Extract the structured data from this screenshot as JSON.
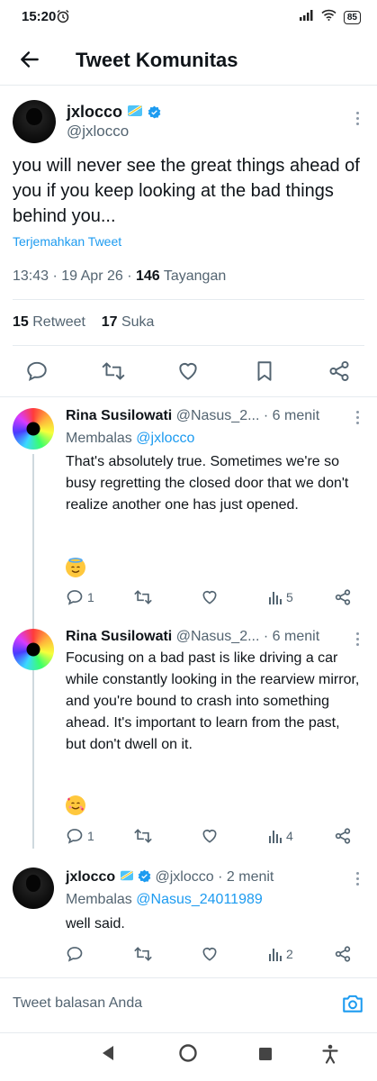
{
  "status_bar": {
    "time": "15:20",
    "battery": "85"
  },
  "header": {
    "title": "Tweet Komunitas"
  },
  "main_tweet": {
    "name": "jxlocco",
    "handle": "@jxlocco",
    "text": "you will never see the great things ahead of you if you keep looking at the bad things behind you...",
    "translate": "Terjemahkan Tweet",
    "time": "13:43",
    "date": "19 Apr 26",
    "views_count": "146",
    "views_label": "Tayangan",
    "retweets_count": "15",
    "retweets_label": "Retweet",
    "likes_count": "17",
    "likes_label": "Suka"
  },
  "replies": [
    {
      "name": "Rina Susilowati",
      "handle": "@Nasus_2...",
      "time": "6 menit",
      "replying_prefix": "Membalas",
      "replying_to": "@jxlocco",
      "text": "That's absolutely true. Sometimes we're so busy regretting the closed door that we don't realize another one has just opened.",
      "emoji": "smiling-face-with-halo",
      "reply_count": "1",
      "views": "5"
    },
    {
      "name": "Rina Susilowati",
      "handle": "@Nasus_2...",
      "time": "6 menit",
      "text": "Focusing on a bad past is like driving a car while constantly looking in the rearview mirror, and you're bound to crash into something ahead. It's important to learn from the past, but don't dwell on it.",
      "emoji": "smiling-face-with-hearts",
      "reply_count": "1",
      "views": "4"
    },
    {
      "name": "jxlocco",
      "handle": "@jxlocco",
      "time": "2 menit",
      "replying_prefix": "Membalas",
      "replying_to": "@Nasus_24011989",
      "text": "well said.",
      "views": "2"
    }
  ],
  "reply_bar": {
    "placeholder": "Tweet balasan Anda"
  },
  "colors": {
    "accent": "#1d9bf0",
    "text": "#0f1419",
    "muted": "#536471"
  }
}
